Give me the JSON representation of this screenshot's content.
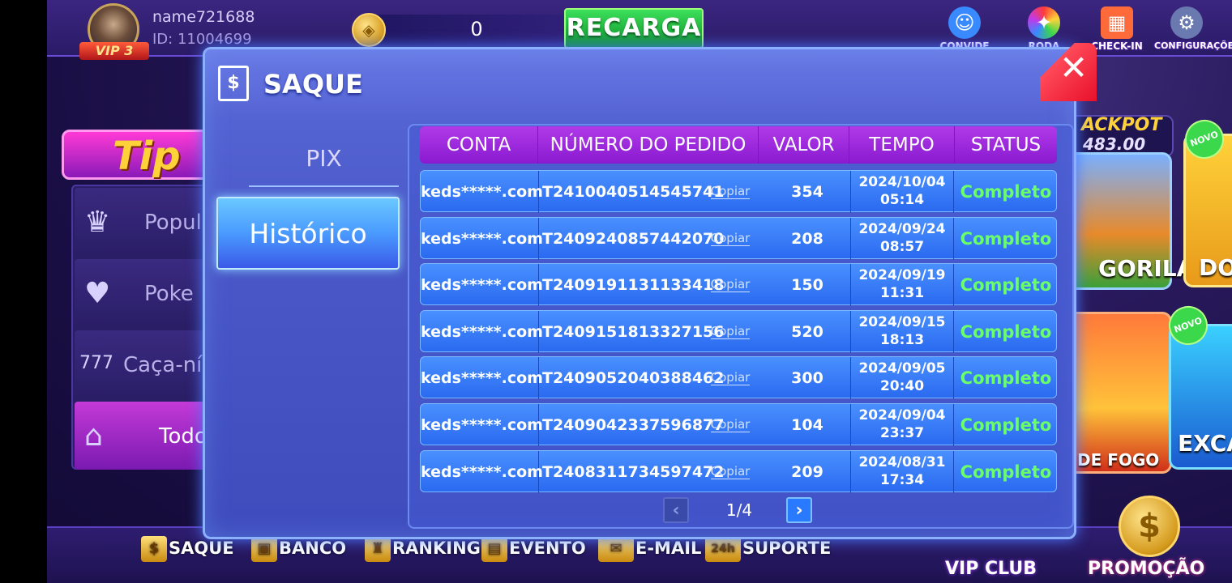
{
  "user": {
    "name": "name721688",
    "id": "ID: 11004699",
    "vip": "VIP 3"
  },
  "wallet": {
    "balance": "0",
    "recharge_label": "RECARGA"
  },
  "top_nav": [
    {
      "label": "CONVIDE",
      "icon": "people-icon"
    },
    {
      "label": "RODA",
      "icon": "wheel-icon"
    },
    {
      "label": "CHECK-IN",
      "icon": "calendar-icon"
    },
    {
      "label": "CONFIGURAÇÕES",
      "icon": "gear-icon"
    }
  ],
  "sidebar": {
    "logo": "Tip",
    "items": [
      {
        "label": "Popul",
        "icon": "crown-icon"
      },
      {
        "label": "Poke",
        "icon": "cards-icon"
      },
      {
        "label": "Caça-níc",
        "icon": "slot-777-icon"
      },
      {
        "label": "Todo",
        "icon": "house-icon"
      }
    ]
  },
  "games": {
    "jackpot_label": "ACKPOT",
    "jackpot_value": "483.00",
    "gorila_label": "GORILA",
    "fogo_label": "DE FOGO",
    "doc_label": "DO",
    "exc_label": "EXCA",
    "novo": "NOVO"
  },
  "bottom_nav": [
    {
      "label": "SAQUE",
      "icon": "bank-icon"
    },
    {
      "label": "BANCO",
      "icon": "safe-icon"
    },
    {
      "label": "RANKING",
      "icon": "trophy-icon"
    },
    {
      "label": "EVENTO",
      "icon": "gift-icon"
    },
    {
      "label": "E-MAIL",
      "icon": "mail-icon"
    },
    {
      "label": "SUPORTE",
      "icon": "support-24h-icon"
    }
  ],
  "vip_club": "VIP CLUB",
  "promo": "PROMOÇÃO",
  "modal": {
    "title": "SAQUE",
    "tabs": {
      "pix": "PIX",
      "history": "Histórico"
    },
    "columns": [
      "CONTA",
      "NÚMERO DO PEDIDO",
      "VALOR",
      "TEMPO",
      "STATUS"
    ],
    "copy_label": "Copiar",
    "rows": [
      {
        "conta": "keds*****.com",
        "numero": "T2410040514545741",
        "valor": "354",
        "data": "2024/10/04",
        "hora": "05:14",
        "status": "Completo"
      },
      {
        "conta": "keds*****.com",
        "numero": "T2409240857442070",
        "valor": "208",
        "data": "2024/09/24",
        "hora": "08:57",
        "status": "Completo"
      },
      {
        "conta": "keds*****.com",
        "numero": "T2409191131133418",
        "valor": "150",
        "data": "2024/09/19",
        "hora": "11:31",
        "status": "Completo"
      },
      {
        "conta": "keds*****.com",
        "numero": "T2409151813327156",
        "valor": "520",
        "data": "2024/09/15",
        "hora": "18:13",
        "status": "Completo"
      },
      {
        "conta": "keds*****.com",
        "numero": "T2409052040388462",
        "valor": "300",
        "data": "2024/09/05",
        "hora": "20:40",
        "status": "Completo"
      },
      {
        "conta": "keds*****.com",
        "numero": "T2409042337596877",
        "valor": "104",
        "data": "2024/09/04",
        "hora": "23:37",
        "status": "Completo"
      },
      {
        "conta": "keds*****.com",
        "numero": "T2408311734597472",
        "valor": "209",
        "data": "2024/08/31",
        "hora": "17:34",
        "status": "Completo"
      }
    ],
    "pagination": "1/4"
  },
  "colors": {
    "status_complete": "#6aff6a",
    "header_purple": "#9a2ae0",
    "row_blue": "#3a7af8",
    "recharge_green": "#1ab83a",
    "close_red": "#e8102a"
  }
}
